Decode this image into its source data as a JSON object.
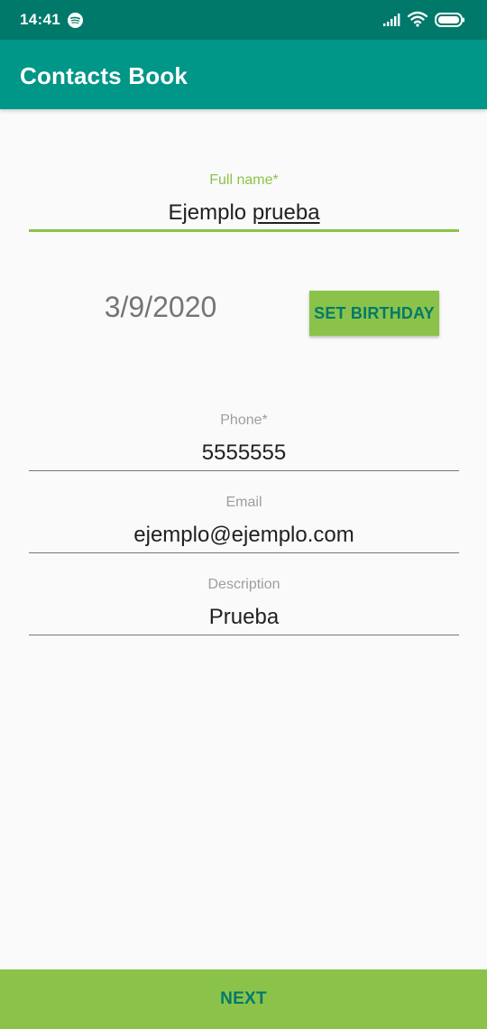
{
  "status_bar": {
    "time": "14:41",
    "icons": [
      "spotify-icon",
      "signal-icon",
      "wifi-icon",
      "battery-icon"
    ]
  },
  "app_bar": {
    "title": "Contacts Book"
  },
  "form": {
    "full_name": {
      "label": "Full name*",
      "value_first": "Ejemplo",
      "value_second": "prueba"
    },
    "birthday": {
      "value": "3/9/2020",
      "button_label": "SET BIRTHDAY"
    },
    "phone": {
      "label": "Phone*",
      "value": "5555555"
    },
    "email": {
      "label": "Email",
      "value": "ejemplo@ejemplo.com"
    },
    "description": {
      "label": "Description",
      "value": "Prueba"
    }
  },
  "footer": {
    "next_label": "NEXT"
  },
  "colors": {
    "status_bar": "#00796b",
    "app_bar": "#009688",
    "accent": "#8bc34a",
    "button_text": "#00796b",
    "background": "#fafafa"
  }
}
